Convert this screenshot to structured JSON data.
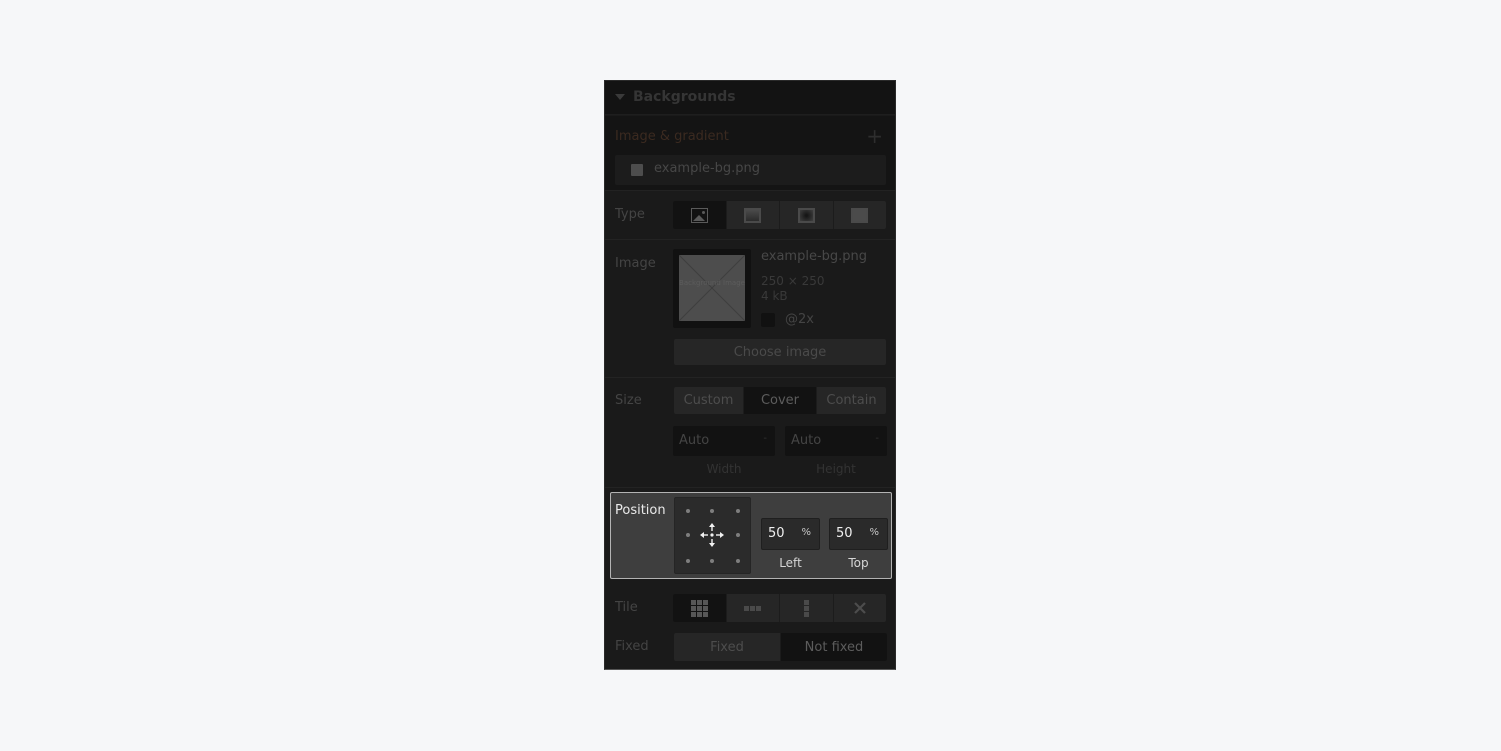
{
  "panel": {
    "title": "Backgrounds",
    "layers_label": "Image & gradient",
    "layers": [
      {
        "name": "example-bg.png"
      }
    ]
  },
  "type": {
    "label": "Type",
    "options": [
      {
        "icon": "image-icon",
        "active": true
      },
      {
        "icon": "linear-gradient-icon",
        "active": false
      },
      {
        "icon": "radial-gradient-icon",
        "active": false
      },
      {
        "icon": "color-overlay-icon",
        "active": false
      }
    ]
  },
  "image": {
    "label": "Image",
    "thumb_caption": "Background Image",
    "filename": "example-bg.png",
    "dimensions": "250 × 250",
    "filesize": "4 kB",
    "retina_label": "@2x",
    "retina_checked": false,
    "choose_label": "Choose image"
  },
  "size": {
    "label": "Size",
    "options": [
      {
        "label": "Custom",
        "active": false
      },
      {
        "label": "Cover",
        "active": true
      },
      {
        "label": "Contain",
        "active": false
      }
    ],
    "width": {
      "value": "Auto",
      "unit": "-",
      "caption": "Width"
    },
    "height": {
      "value": "Auto",
      "unit": "-",
      "caption": "Height"
    }
  },
  "position": {
    "label": "Position",
    "left": {
      "value": "50",
      "unit": "%",
      "caption": "Left"
    },
    "top": {
      "value": "50",
      "unit": "%",
      "caption": "Top"
    }
  },
  "tile": {
    "label": "Tile",
    "options": [
      {
        "icon": "tile-both-icon",
        "active": true
      },
      {
        "icon": "tile-horizontal-icon",
        "active": false
      },
      {
        "icon": "tile-vertical-icon",
        "active": false
      },
      {
        "icon": "no-tile-icon",
        "active": false
      }
    ]
  },
  "fixed": {
    "label": "Fixed",
    "options": [
      {
        "label": "Fixed",
        "active": false
      },
      {
        "label": "Not fixed",
        "active": true
      }
    ]
  },
  "colors": {
    "page_bg": "#f6f7f9",
    "panel_bg": "#1a1a1a",
    "highlight_bg": "#3e3e3e",
    "highlight_border": "#b3b3b3"
  }
}
